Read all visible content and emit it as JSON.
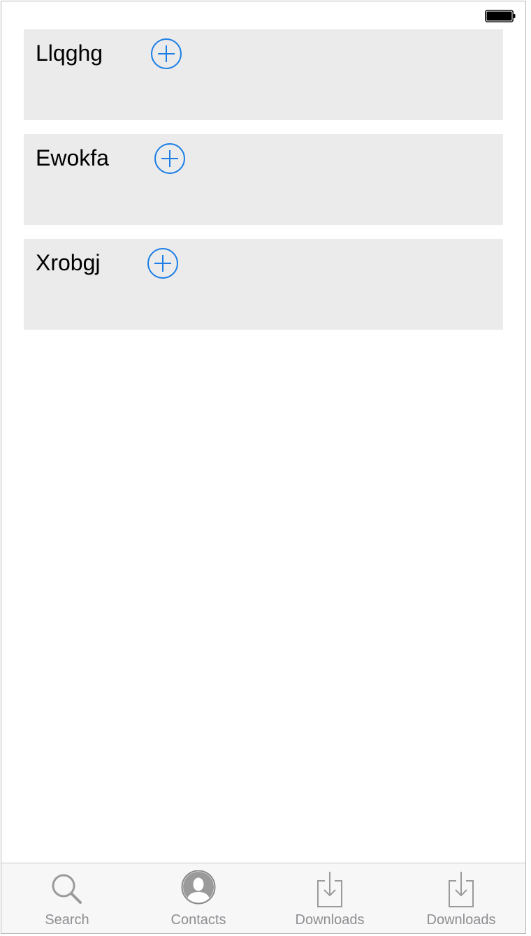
{
  "colors": {
    "accent": "#1a7ee6",
    "card_bg": "#ebebeb",
    "tab_inactive": "#8e8e93",
    "tab_bar_bg": "#f7f7f7"
  },
  "status_bar": {
    "battery_icon": "battery-full-icon"
  },
  "cards": [
    {
      "title": "Llqghg",
      "add_icon": "plus-circle-icon"
    },
    {
      "title": "Ewokfa",
      "add_icon": "plus-circle-icon"
    },
    {
      "title": "Xrobgj",
      "add_icon": "plus-circle-icon"
    }
  ],
  "tab_bar": {
    "tabs": [
      {
        "label": "Search",
        "icon": "search-icon"
      },
      {
        "label": "Contacts",
        "icon": "contact-icon"
      },
      {
        "label": "Downloads",
        "icon": "download-icon"
      },
      {
        "label": "Downloads",
        "icon": "download-icon"
      }
    ]
  }
}
